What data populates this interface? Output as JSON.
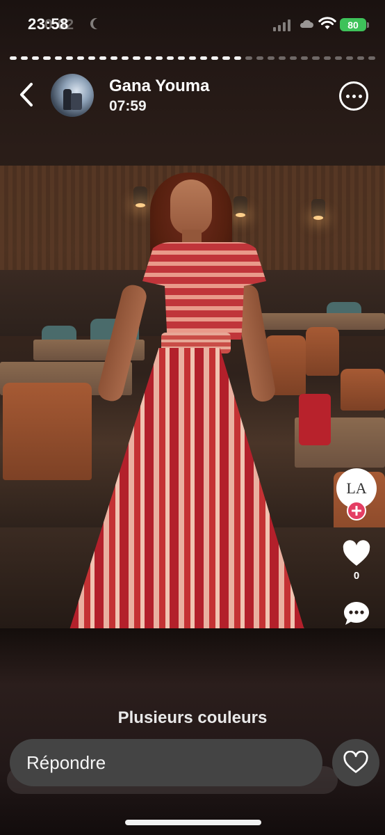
{
  "status_bar": {
    "time": "23:58",
    "ghost_time": "0:02",
    "battery": "80"
  },
  "story": {
    "segments_total": 33,
    "segments_done": 21
  },
  "header": {
    "user_name": "Gana Youma",
    "timestamp": "07:59"
  },
  "actions": {
    "profile_initials": "LA",
    "like_count": "0"
  },
  "caption": "Plusieurs couleurs",
  "reply": {
    "placeholder": "Répondre"
  },
  "icons": {
    "back": "chevron-left-icon",
    "more": "more-horizontal-icon",
    "like": "heart-icon",
    "comment": "comment-icon",
    "add": "plus-icon",
    "reply_like": "heart-outline-icon"
  },
  "colors": {
    "battery": "#3ec25a",
    "add_button": "#e43e63",
    "reply_bg": "#444444"
  }
}
